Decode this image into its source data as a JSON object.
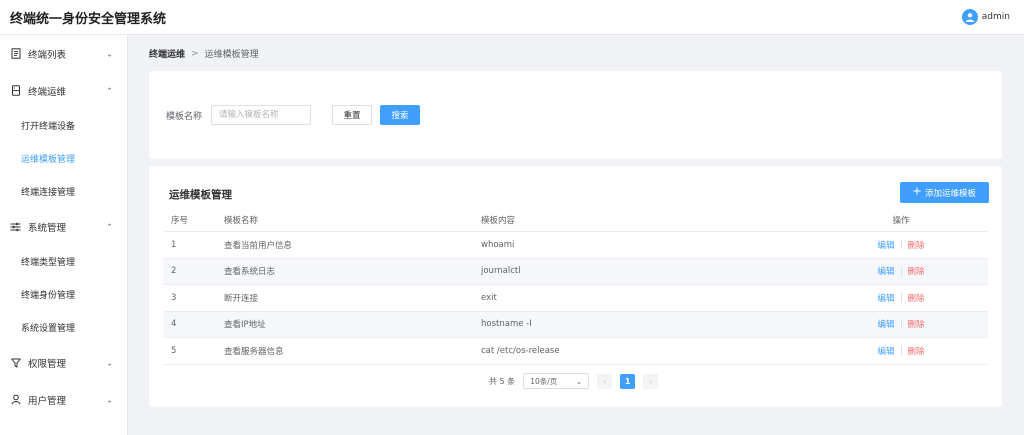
{
  "header": {
    "title": "终端统一身份安全管理系统",
    "user": "admin"
  },
  "sidebar": {
    "groups": [
      {
        "label": "终端列表",
        "icon": "document-icon",
        "expanded": false,
        "items": []
      },
      {
        "label": "终端运维",
        "icon": "server-icon",
        "expanded": true,
        "items": [
          "打开终端设备",
          "运维模板管理",
          "终端连接管理"
        ]
      },
      {
        "label": "系统管理",
        "icon": "sliders-icon",
        "expanded": true,
        "items": [
          "终端类型管理",
          "终端身份管理",
          "系统设置管理"
        ]
      },
      {
        "label": "权限管理",
        "icon": "filter-icon",
        "expanded": false,
        "items": []
      },
      {
        "label": "用户管理",
        "icon": "user-icon",
        "expanded": false,
        "items": []
      }
    ],
    "active_item": "运维模板管理"
  },
  "breadcrumb": {
    "first": "终端运维",
    "separator": ">",
    "current": "运维模板管理"
  },
  "search": {
    "label": "模板名称",
    "placeholder": "请输入模板名称",
    "value": "",
    "reset_label": "重置",
    "search_label": "搜索"
  },
  "table": {
    "title": "运维模板管理",
    "add_label": "添加运维模板",
    "columns": [
      "序号",
      "模板名称",
      "模板内容",
      "操作"
    ],
    "rows": [
      {
        "index": "1",
        "name": "查看当前用户信息",
        "content": "whoami"
      },
      {
        "index": "2",
        "name": "查看系统日志",
        "content": "journalctl"
      },
      {
        "index": "3",
        "name": "断开连接",
        "content": "exit"
      },
      {
        "index": "4",
        "name": "查看IP地址",
        "content": "hostname -I"
      },
      {
        "index": "5",
        "name": "查看服务器信息",
        "content": "cat /etc/os-release"
      }
    ],
    "edit_label": "编辑",
    "delete_label": "删除"
  },
  "pagination": {
    "total_text": "共 5 条",
    "page_size": "10条/页",
    "current_page": "1"
  },
  "colors": {
    "primary": "#409eff",
    "danger": "#f56c6c"
  }
}
